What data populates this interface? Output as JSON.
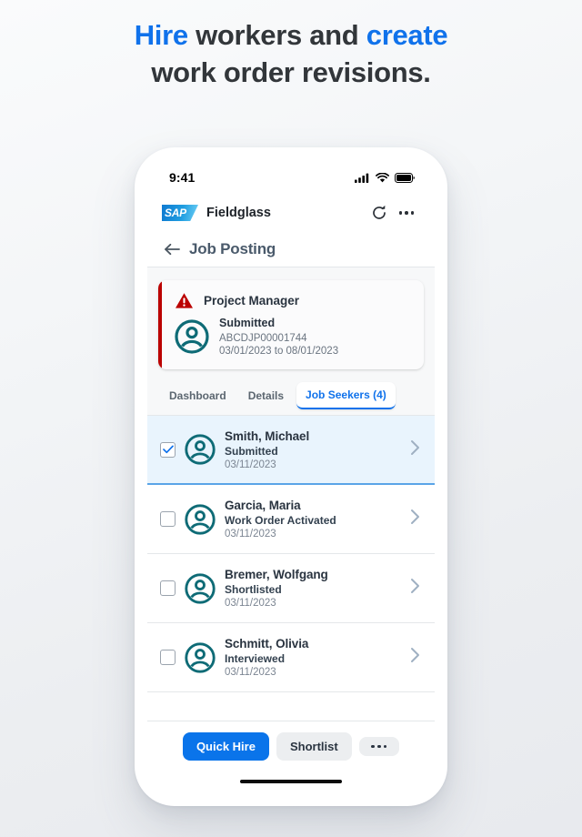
{
  "headline": {
    "line1_part1": "Hire",
    "line1_part2": " workers and ",
    "line1_part3": "create",
    "line2": "work order revisions."
  },
  "colors": {
    "accent_blue": "#1072eb",
    "primary_button": "#0a74ea",
    "teal_avatar": "#0e6b76",
    "alert_red": "#bb0000",
    "selected_row_bg": "#e9f4fd"
  },
  "status_bar": {
    "time": "9:41",
    "signal_icon": "cellular-signal-icon",
    "wifi_icon": "wifi-icon",
    "battery_icon": "battery-icon"
  },
  "app_header": {
    "logo": "sap-logo",
    "logo_text": "SAP",
    "app_name": "Fieldglass",
    "refresh_icon": "refresh-icon",
    "overflow_icon": "more-options-icon"
  },
  "page": {
    "back_icon": "back-arrow-icon",
    "title": "Job Posting"
  },
  "job_card": {
    "warning_icon": "warning-triangle-icon",
    "title": "Project Manager",
    "avatar_icon": "person-avatar-icon",
    "status": "Submitted",
    "id": "ABCDJP00001744",
    "dates": "03/01/2023 to 08/01/2023"
  },
  "tabs": [
    {
      "label": "Dashboard",
      "active": false
    },
    {
      "label": "Details",
      "active": false
    },
    {
      "label": "Job Seekers (4)",
      "active": true
    }
  ],
  "job_seekers": [
    {
      "name": "Smith, Michael",
      "status": "Submitted",
      "date": "03/11/2023",
      "selected": true,
      "checkbox_icon": "checkbox-checked-icon",
      "chevron_icon": "chevron-right-icon"
    },
    {
      "name": "Garcia, Maria",
      "status": "Work Order Activated",
      "date": "03/11/2023",
      "selected": false,
      "checkbox_icon": "checkbox-unchecked-icon",
      "chevron_icon": "chevron-right-icon"
    },
    {
      "name": "Bremer, Wolfgang",
      "status": "Shortlisted",
      "date": "03/11/2023",
      "selected": false,
      "checkbox_icon": "checkbox-unchecked-icon",
      "chevron_icon": "chevron-right-icon"
    },
    {
      "name": "Schmitt, Olivia",
      "status": "Interviewed",
      "date": "03/11/2023",
      "selected": false,
      "checkbox_icon": "checkbox-unchecked-icon",
      "chevron_icon": "chevron-right-icon"
    }
  ],
  "action_bar": {
    "quick_hire_label": "Quick Hire",
    "shortlist_label": "Shortlist",
    "more_icon": "more-actions-icon"
  },
  "home_indicator": "home-indicator-bar"
}
